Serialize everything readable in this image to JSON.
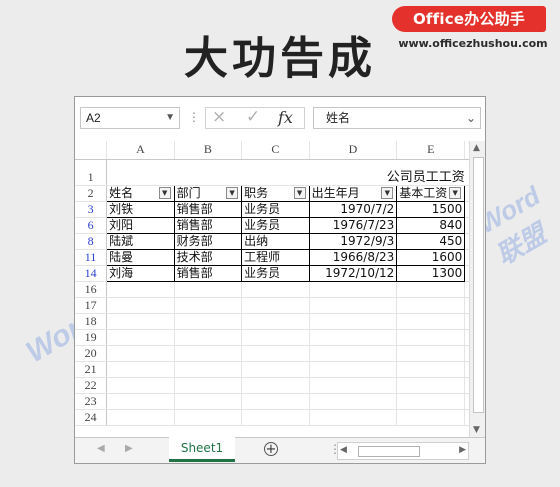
{
  "brand": {
    "logo": "Office办公助手",
    "site": "www.officezhushou.com",
    "watermark": "Word联盟"
  },
  "headline": "大功告成",
  "formula_bar": {
    "name_box": "A2",
    "cancel_icon": "×",
    "enter_icon": "✓",
    "fx_label": "fx",
    "content": "姓名"
  },
  "columns": [
    "A",
    "B",
    "C",
    "D",
    "E"
  ],
  "title_row": {
    "row": "1",
    "text": "公司员工工资"
  },
  "header_row": {
    "row": "2",
    "cells": [
      "姓名",
      "部门",
      "职务",
      "出生年月",
      "基本工资"
    ]
  },
  "rows": [
    {
      "row": "3",
      "cells": [
        "刘铁",
        "销售部",
        "业务员",
        "1970/7/2",
        "1500"
      ]
    },
    {
      "row": "6",
      "cells": [
        "刘阳",
        "销售部",
        "业务员",
        "1976/7/23",
        "840"
      ]
    },
    {
      "row": "8",
      "cells": [
        "陆斌",
        "财务部",
        "出纳",
        "1972/9/3",
        "450"
      ]
    },
    {
      "row": "11",
      "cells": [
        "陆曼",
        "技术部",
        "工程师",
        "1966/8/23",
        "1600"
      ]
    },
    {
      "row": "14",
      "cells": [
        "刘海",
        "销售部",
        "业务员",
        "1972/10/12",
        "1300"
      ]
    }
  ],
  "empty_rows": [
    "16",
    "17",
    "18",
    "19",
    "20",
    "21",
    "22",
    "23",
    "24"
  ],
  "sheet_tab": "Sheet1",
  "add_sheet_label": "+",
  "colors": {
    "accent": "#217346",
    "logo_bg": "#e4312b",
    "filtered_row_number": "#2a3fd0"
  }
}
